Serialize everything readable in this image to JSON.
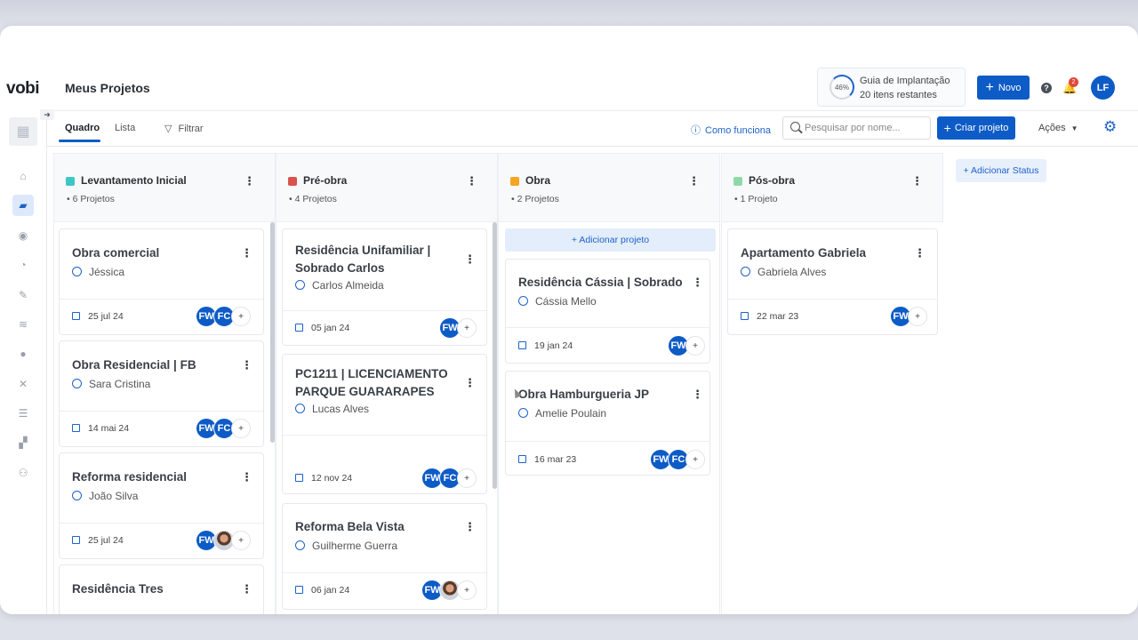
{
  "app": {
    "logo": "vobi",
    "page_title": "Meus Projetos"
  },
  "guide": {
    "percent": "46%",
    "title": "Guia de Implantação",
    "subtitle": "20 itens restantes"
  },
  "header": {
    "new_label": "Novo",
    "notif_count": "2",
    "user_initials": "LF"
  },
  "toolbar": {
    "tabs": [
      {
        "label": "Quadro"
      },
      {
        "label": "Lista"
      }
    ],
    "filter_label": "Filtrar",
    "how_label": "Como funciona",
    "search_placeholder": "Pesquisar por nome...",
    "create_label": "Criar projeto",
    "actions_label": "Ações"
  },
  "board": {
    "add_status_label": "+ Adicionar Status",
    "add_project_label": "+ Adicionar projeto",
    "columns": [
      {
        "name": "Levantamento Inicial",
        "count": "• 6 Projetos",
        "color": "#3cc6c6",
        "cards": [
          {
            "title": "Obra comercial",
            "person": "Jéssica",
            "date": "25 jul 24"
          },
          {
            "title": "Obra Residencial | FB",
            "person": "Sara Cristina",
            "date": "14 mai 24"
          },
          {
            "title": "Reforma residencial",
            "person": "João Silva",
            "date": "25 jul 24"
          },
          {
            "title": "Residência Tres"
          }
        ]
      },
      {
        "name": "Pré-obra",
        "count": "• 4 Projetos",
        "color": "#d9534f",
        "cards": [
          {
            "title": "Residência Unifamiliar | Sobrado Carlos",
            "person": "Carlos Almeida",
            "date": "05 jan 24"
          },
          {
            "title": "PC1211 | LICENCIAMENTO PARQUE GUARARAPES",
            "person": "Lucas Alves",
            "date": "12 nov 24"
          },
          {
            "title": "Reforma Bela Vista",
            "person": "Guilherme Guerra",
            "date": "06 jan 24"
          }
        ]
      },
      {
        "name": "Obra",
        "count": "• 2 Projetos",
        "color": "#f5a524",
        "cards": [
          {
            "title": "Residência Cássia | Sobrado",
            "person": "Cássia Mello",
            "date": "19 jan 24"
          },
          {
            "title": "Obra Hamburgueria JP",
            "person": "Amelie Poulain",
            "date": "16 mar 23"
          }
        ]
      },
      {
        "name": "Pós-obra",
        "count": "• 1 Projeto",
        "color": "#8fd9a8",
        "cards": [
          {
            "title": "Apartamento Gabriela",
            "person": "Gabriela Alves",
            "date": "22 mar 23"
          }
        ]
      }
    ]
  },
  "avatars": {
    "fw": "FW",
    "fc": "FC",
    "more": "+"
  }
}
